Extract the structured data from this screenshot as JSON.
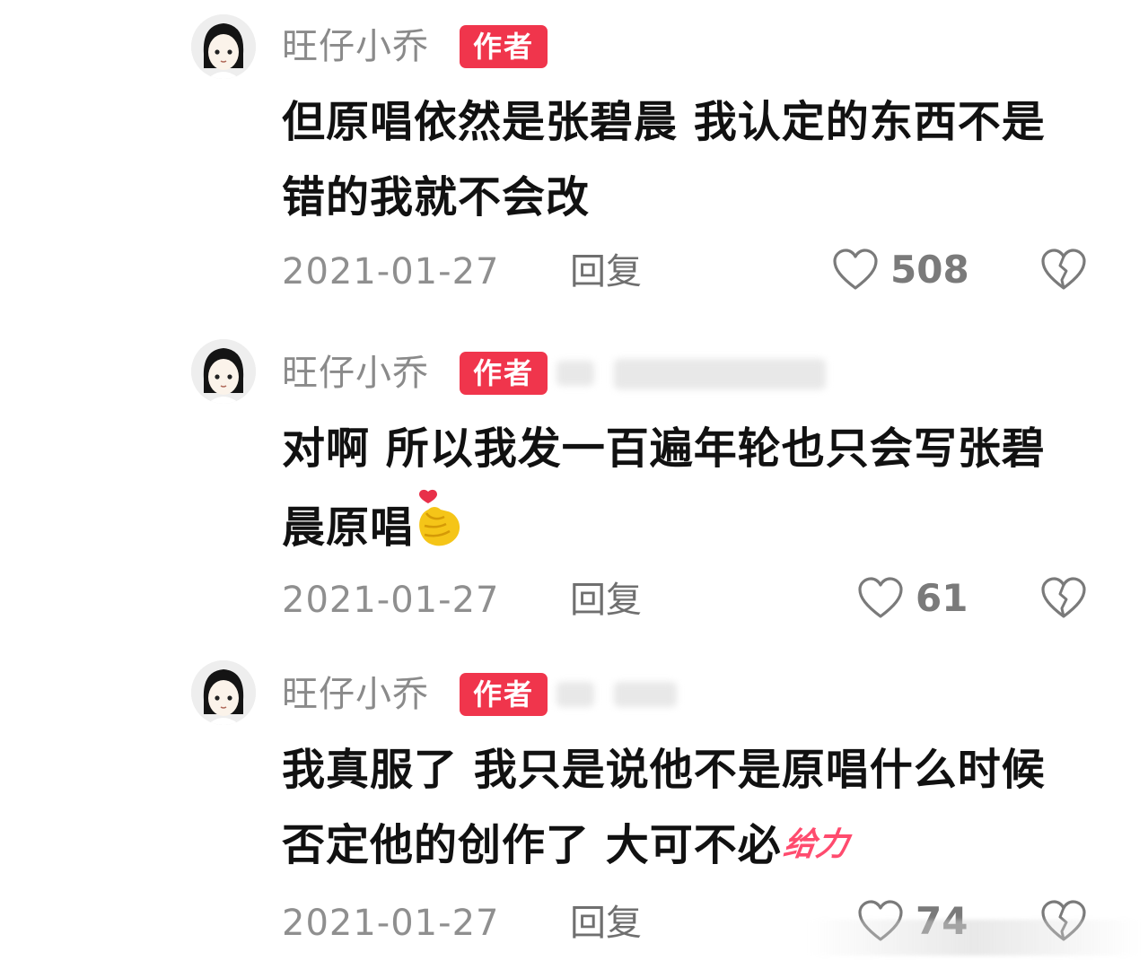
{
  "comments": [
    {
      "username": "旺仔小乔",
      "badge": "作者",
      "text": "但原唱依然是张碧晨 我认定的东西不是错的我就不会改",
      "date": "2021-01-27",
      "reply_label": "回复",
      "likes": "508"
    },
    {
      "username": "旺仔小乔",
      "badge": "作者",
      "text": "对啊 所以我发一百遍年轮也只会写张碧晨原唱",
      "emoji": "finger-heart-emoji",
      "date": "2021-01-27",
      "reply_label": "回复",
      "likes": "61"
    },
    {
      "username": "旺仔小乔",
      "badge": "作者",
      "text": "我真服了 我只是说他不是原唱什么时候否定他的创作了 大可不必",
      "sticker_text": "给力",
      "date": "2021-01-27",
      "reply_label": "回复",
      "likes": "74"
    }
  ],
  "colors": {
    "badge_bg": "#f0354c",
    "username": "#8a8a8a",
    "meta": "#8f8f8f",
    "sticker": "#ff4b6e"
  }
}
